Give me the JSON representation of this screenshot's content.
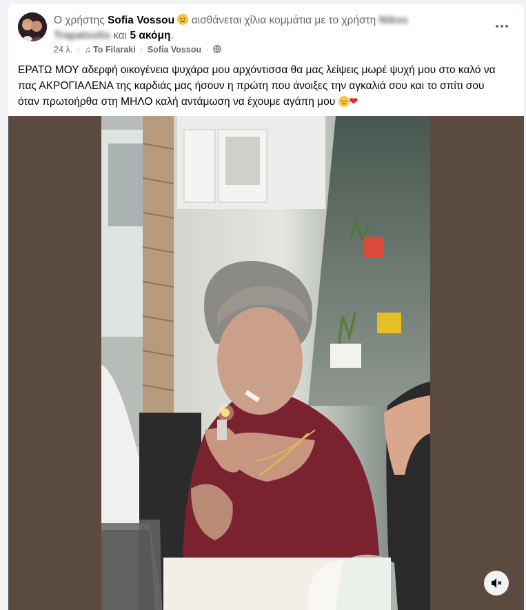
{
  "post": {
    "prefix": "Ο χρήστης",
    "author": "Sofia Vossou",
    "feeling_text": "αισθάνεται χίλια κομμάτια με το χρήστη",
    "tagged_blurred_line1": "Nikos",
    "tagged_blurred_line2": "Trapatsolis",
    "and_text": "και",
    "others": "5 ακόμη",
    "period": ".",
    "time": "24 λ.",
    "music_icon": "music-note-icon",
    "song": "To Filaraki",
    "song_artist": "Sofia Vossou",
    "audience_icon": "globe-icon",
    "text": "ΕΡΑΤΩ ΜΟΥ αδερφή οικογένεια ψυχάρα μου αρχόντισσα θα μας λείψεις μωρέ ψυχή μου στο καλό να πας ΑΚΡΟΓΙΑΛΕΝΑ της καρδιάς μας ήσουν η πρώτη που άνοιξες την αγκαλιά σου και το σπίτι σου όταν πρωτοήρθα στη ΜΗΛΟ καλή αντάμωση να έχουμε αγάπη μου",
    "trailing_emojis": [
      "sad-face-emoji",
      "red-heart-emoji"
    ]
  },
  "icons": {
    "more": "more-options-icon",
    "mute": "speaker-muted-icon"
  },
  "colors": {
    "bg": "#f0f2f5",
    "card": "#ffffff",
    "secondary_text": "#65676b",
    "media_bg": "#5a4a3f"
  }
}
